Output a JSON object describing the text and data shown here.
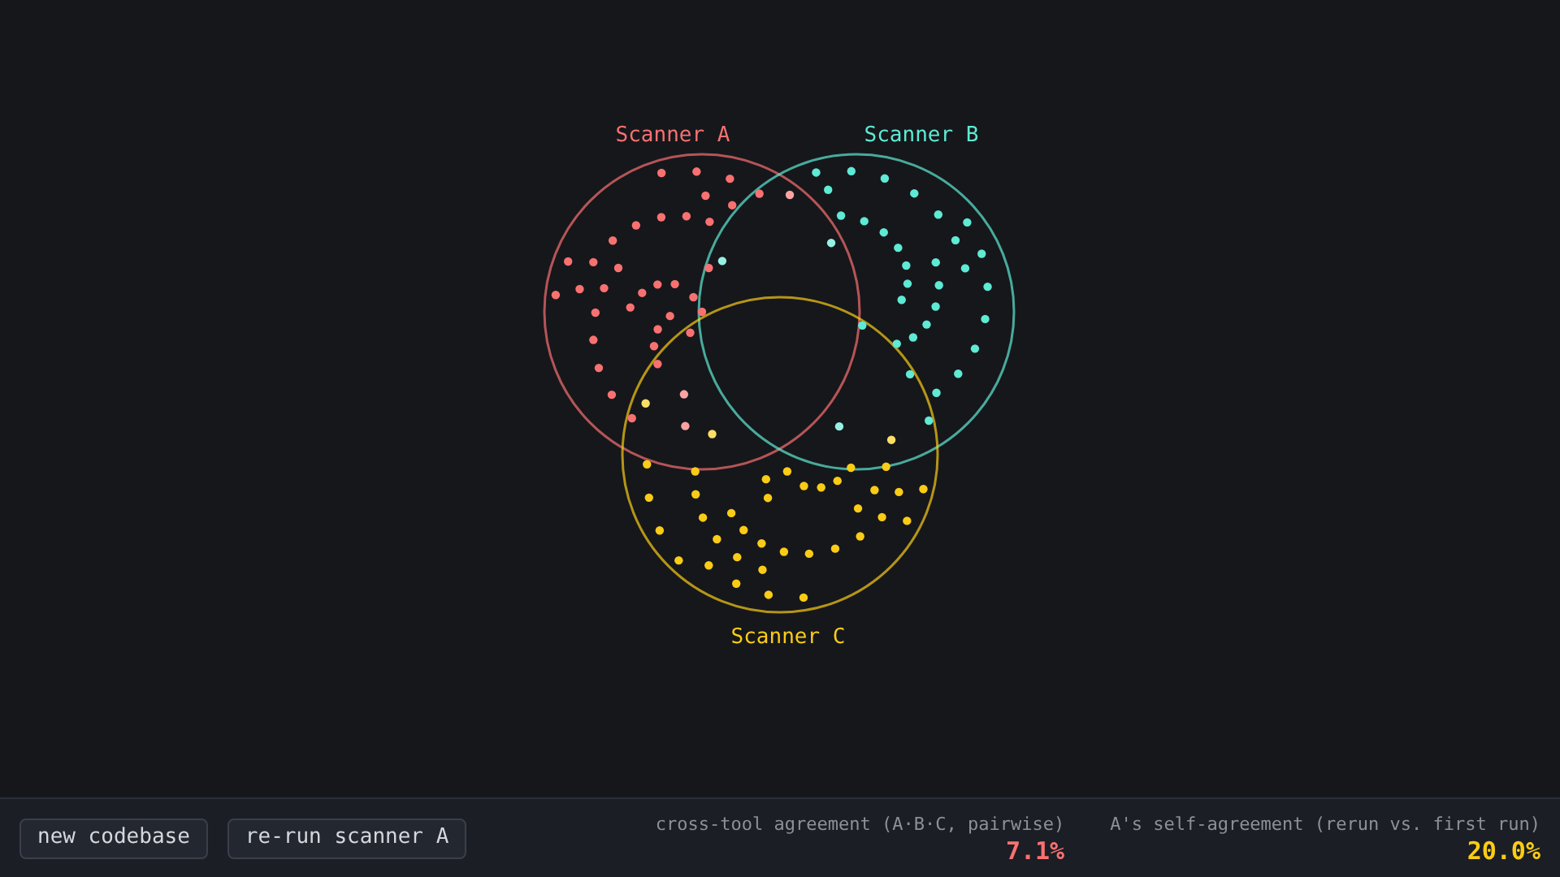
{
  "venn": {
    "sets": [
      {
        "label": "Scanner A",
        "color": "#f87171"
      },
      {
        "label": "Scanner B",
        "color": "#5eead4"
      },
      {
        "label": "Scanner C",
        "color": "#facc15"
      }
    ]
  },
  "footer": {
    "buttons": [
      "new codebase",
      "re-run scanner A"
    ],
    "stats": [
      {
        "label": "cross-tool agreement (A·B·C, pairwise)",
        "value": "7.1%",
        "color": "#f87171"
      },
      {
        "label": "A's self-agreement (rerun vs. first run)",
        "value": "20.0%",
        "color": "#facc15"
      }
    ]
  }
}
